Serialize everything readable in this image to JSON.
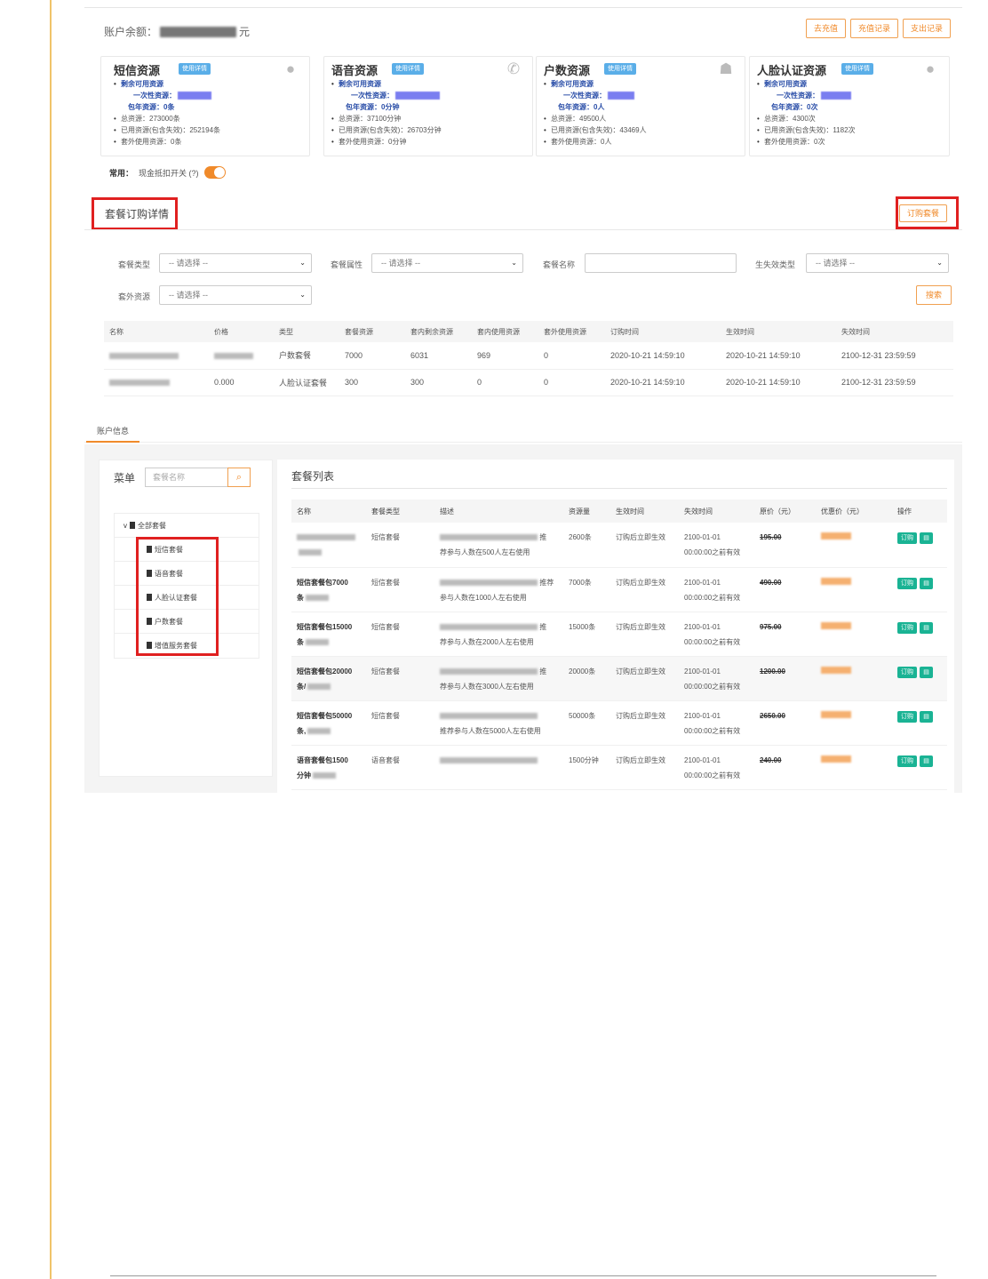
{
  "account": {
    "balance_label": "账户余额：",
    "balance_unit": "元",
    "buttons": {
      "recharge": "去充值",
      "recharge_record": "充值记录",
      "expense_record": "支出记录"
    }
  },
  "resources": [
    {
      "title": "短信资源",
      "tag": "使用详情",
      "icon": "chat-bubble-icon",
      "remaining": "剩余可用资源",
      "one_time": "一次性资源：",
      "yearly": "包年资源：0条",
      "total": "总资源：273000条",
      "used": "已用资源(包含失效)：252194条",
      "extra": "套外使用资源：0条"
    },
    {
      "title": "语音资源",
      "tag": "使用详情",
      "icon": "phone-icon",
      "remaining": "剩余可用资源",
      "one_time": "一次性资源：",
      "yearly": "包年资源：0分钟",
      "total": "总资源：37100分钟",
      "used": "已用资源(包含失效)：26703分钟",
      "extra": "套外使用资源：0分钟"
    },
    {
      "title": "户数资源",
      "tag": "使用详情",
      "icon": "users-icon",
      "remaining": "剩余可用资源",
      "one_time": "一次性资源：",
      "yearly": "包年资源：0人",
      "total": "总资源：49500人",
      "used": "已用资源(包含失效)：43469人",
      "extra": "套外使用资源：0人"
    },
    {
      "title": "人脸认证资源",
      "tag": "使用详情",
      "icon": "user-icon",
      "remaining": "剩余可用资源",
      "one_time": "一次性资源：",
      "yearly": "包年资源：0次",
      "total": "总资源：4300次",
      "used": "已用资源(包含失效)：1182次",
      "extra": "套外使用资源：0次"
    }
  ],
  "common": {
    "label": "常用：",
    "switch_label": "现金抵扣开关 (?)",
    "switch_on": true
  },
  "subscription": {
    "title": "套餐订购详情",
    "order_button": "订购套餐",
    "filters": {
      "type_label": "套餐类型",
      "type_value": "-- 请选择 --",
      "attr_label": "套餐属性",
      "attr_value": "-- 请选择 --",
      "name_label": "套餐名称",
      "name_value": "",
      "expire_label": "生失效类型",
      "expire_value": "-- 请选择 --",
      "extra_label": "套外资源",
      "extra_value": "-- 请选择 --"
    },
    "search_button": "搜索",
    "columns": [
      "名称",
      "价格",
      "类型",
      "套餐资源",
      "套内剩余资源",
      "套内使用资源",
      "套外使用资源",
      "订购时间",
      "生效时间",
      "失效时间"
    ],
    "rows": [
      {
        "price": "",
        "type": "户数套餐",
        "res": "7000",
        "remain": "6031",
        "used": "969",
        "extra": "0",
        "order": "2020-10-21 14:59:10",
        "start": "2020-10-21 14:59:10",
        "end": "2100-12-31 23:59:59"
      },
      {
        "price": "0.000",
        "type": "人脸认证套餐",
        "res": "300",
        "remain": "300",
        "used": "0",
        "extra": "0",
        "order": "2020-10-21 14:59:10",
        "start": "2020-10-21 14:59:10",
        "end": "2100-12-31 23:59:59"
      }
    ]
  },
  "tabs": {
    "account_info": "账户信息"
  },
  "menu": {
    "title": "菜单",
    "search_placeholder": "套餐名称",
    "root": "全部套餐",
    "items": [
      "短信套餐",
      "语音套餐",
      "人脸认证套餐",
      "户数套餐",
      "增值服务套餐"
    ]
  },
  "package_list": {
    "title": "套餐列表",
    "columns": [
      "名称",
      "套餐类型",
      "描述",
      "资源量",
      "生效时间",
      "失效时间",
      "原价（元）",
      "优惠价（元）",
      "操作"
    ],
    "order_label": "订购",
    "rows": [
      {
        "name1": "",
        "name2": "",
        "type": "短信套餐",
        "desc_tail": "推",
        "desc2": "荐参与人数在500人左右使用",
        "amount": "2600条",
        "effect": "订购后立即生效",
        "expire1": "2100-01-01",
        "expire2": "00:00:00之前有效",
        "price": "195.00"
      },
      {
        "name1": "短信套餐包7000",
        "name2": "条",
        "type": "短信套餐",
        "desc_tail": "推荐",
        "desc2": "参与人数在1000人左右使用",
        "amount": "7000条",
        "effect": "订购后立即生效",
        "expire1": "2100-01-01",
        "expire2": "00:00:00之前有效",
        "price": "490.00"
      },
      {
        "name1": "短信套餐包15000",
        "name2": "条",
        "type": "短信套餐",
        "desc_tail": "推",
        "desc2": "荐参与人数在2000人左右使用",
        "amount": "15000条",
        "effect": "订购后立即生效",
        "expire1": "2100-01-01",
        "expire2": "00:00:00之前有效",
        "price": "975.00"
      },
      {
        "name1": "短信套餐包20000",
        "name2": "条/",
        "type": "短信套餐",
        "desc_tail": "推",
        "desc2": "荐参与人数在3000人左右使用",
        "amount": "20000条",
        "effect": "订购后立即生效",
        "expire1": "2100-01-01",
        "expire2": "00:00:00之前有效",
        "price": "1200.00"
      },
      {
        "name1": "短信套餐包50000",
        "name2": "条,",
        "type": "短信套餐",
        "desc_tail": "",
        "desc2": "推荐参与人数在5000人左右使用",
        "amount": "50000条",
        "effect": "订购后立即生效",
        "expire1": "2100-01-01",
        "expire2": "00:00:00之前有效",
        "price": "2650.00"
      },
      {
        "name1": "语音套餐包1500",
        "name2": "分钟",
        "type": "语音套餐",
        "desc_tail": "",
        "desc2": "",
        "amount": "1500分钟",
        "effect": "订购后立即生效",
        "expire1": "2100-01-01",
        "expire2": "00:00:00之前有效",
        "price": "240.00"
      }
    ]
  }
}
